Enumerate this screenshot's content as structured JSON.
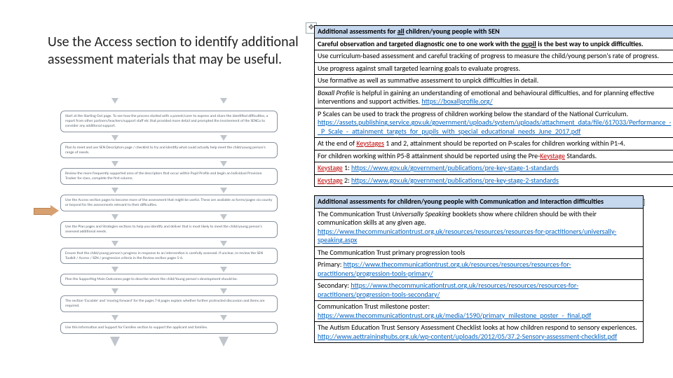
{
  "instruction": "Use the Access section to identify additional assessment materials that may be useful.",
  "flow": {
    "steps": [
      "Start at the Starting Out page. To see how the process started with a parent/carer to express and share the identified difficulties, a report from other partners/teachers/support staff etc that provided more detail and prompted the involvement of the SENCo to consider any additional support.",
      "Plan to meet and use SEN Descriptors page / checklist to try and identify what could actually help meet the child/young person's range of needs.",
      "Review the more frequently supported area of the descriptors that occur within Pupil Profile and begin an Individual Provision Tracker for class, complete the first column.",
      "Use the Access section pages to become more of the assessment that might be useful. These are available as forms/pages via county or beyond for the assessments relevant to their difficulties.",
      "Use the Plan pages and Strategies sections to help you identify and deliver that is most likely to meet the child/young person's assessed additional needs.",
      "Ensure that the child/young person's progress in response to an intervention is carefully assessed. If unclear, re-review the SEN Toolkit / Access / SEN / progression criteria in the Review section pages 5-6.",
      "Plan the Supporting Main Outcomes page to describe where the child/Young person's development should be.",
      "The section 'Escalate' and 'moving forward' for the pages 7-8 pages explain whether further protracted discussion and items are required.",
      "Use this Information and Support for Families section to support the applicant and families."
    ]
  },
  "table1": {
    "header": [
      "Additional assessments for ",
      "all",
      " children/young people with SEN"
    ],
    "rows": [
      {
        "bold": true,
        "parts": [
          "Careful observation and targeted diagnostic one to one work with the ",
          {
            "u": true,
            "t": "pupil"
          },
          " is the best way to unpick difficulties."
        ]
      },
      {
        "parts": [
          "Use curriculum-based assessment and careful tracking of progress to measure the child/young person's rate of progress."
        ]
      },
      {
        "parts": [
          "Use progress against small targeted learning goals to evaluate progress."
        ]
      },
      {
        "parts": [
          "Use formative as well as summative assessment to unpick difficulties in detail."
        ]
      },
      {
        "parts": [
          {
            "it": true,
            "t": "Boxall Profile"
          },
          " is helpful in gaining an understanding of emotional and behavioural difficulties, and for planning effective interventions and support activities. ",
          {
            "lk": true,
            "t": "https://boxallprofile.org/"
          }
        ]
      },
      {
        "parts": [
          "P Scales can be used to track the progress of children working below the standard of the National Curriculum. ",
          {
            "lk": true,
            "t": "https://assets.publishing.service.gov.uk/government/uploads/system/uploads/attachment_data/file/617033/Performance_-_P_Scale_-_attainment_targets_for_pupils_with_special_educational_needs_June_2017.pdf"
          }
        ]
      },
      {
        "parts": [
          "At the end of ",
          {
            "rd": true,
            "t": "Keystages"
          },
          " 1 and 2, attainment should be reported on P-scales for children working within P1-4."
        ]
      },
      {
        "parts": [
          "For children working within P5-8 attainment should be reported using the Pre-",
          {
            "rd": true,
            "t": "Keystage"
          },
          " Standards."
        ]
      },
      {
        "parts": [
          {
            "rd": true,
            "t": "Keystage"
          },
          " 1: ",
          {
            "lk": true,
            "t": "https://www.gov.uk/government/publications/pre-key-stage-1-standards"
          }
        ]
      },
      {
        "parts": [
          {
            "rd": true,
            "t": "Keystage"
          },
          " 2: ",
          {
            "lk": true,
            "t": "https://www.gov.uk/government/publications/pre-key-stage-2-standards"
          }
        ]
      }
    ]
  },
  "table2": {
    "header": "Additional assessments for children/young people with Communication and Interaction difficulties",
    "rows": [
      {
        "parts": [
          "The Communication Trust ",
          {
            "it": true,
            "t": "Universally Speaking"
          },
          " booklets show where children should be with their communication skills at any given age. ",
          {
            "lk": true,
            "t": "https://www.thecommunicationtrust.org.uk/resources/resources/resources-for-practitioners/universally-speaking.aspx"
          }
        ]
      },
      {
        "parts": [
          "The Communication Trust primary progression tools"
        ]
      },
      {
        "parts": [
          "Primary: ",
          {
            "lk": true,
            "t": "https://www.thecommunicationtrust.org.uk/resources/resources/resources-for-practitioners/progression-tools-primary/"
          }
        ]
      },
      {
        "parts": [
          "Secondary: ",
          {
            "lk": true,
            "t": "https://www.thecommunicationtrust.org.uk/resources/resources/resources-for-practitioners/progression-tools-secondary/"
          }
        ]
      },
      {
        "parts": [
          "Communication Trust milestone poster: ",
          {
            "lk": true,
            "t": "https://www.thecommunicationtrust.org.uk/media/1590/primary_milestone_poster_-_final.pdf"
          }
        ]
      },
      {
        "parts": [
          "The Autism Education Trust Sensory Assessment Checklist looks at how children respond to sensory experiences. ",
          {
            "lk": true,
            "t": "http://www.aettraininghubs.org.uk/wp-content/uploads/2012/05/37.2-Sensory-assessment-checklist.pdf"
          }
        ]
      }
    ]
  },
  "handle_glyph": "✥"
}
